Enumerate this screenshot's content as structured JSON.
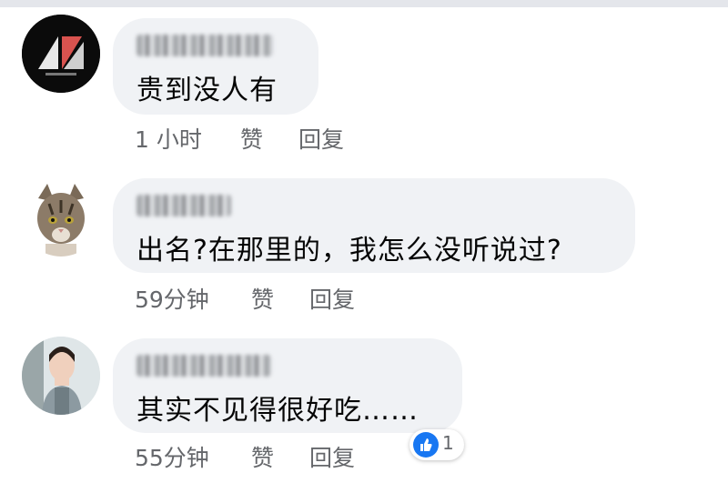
{
  "comments": [
    {
      "text": "贵到没人有",
      "time": "1 小时",
      "like_label": "赞",
      "reply_label": "回复"
    },
    {
      "text": "出名?在那里的，我怎么没听说过?",
      "time": "59分钟",
      "like_label": "赞",
      "reply_label": "回复"
    },
    {
      "text": "其实不见得很好吃……",
      "time": "55分钟",
      "like_label": "赞",
      "reply_label": "回复",
      "reaction": {
        "icon": "like-icon",
        "count": "1",
        "color": "#1877f2"
      }
    }
  ]
}
